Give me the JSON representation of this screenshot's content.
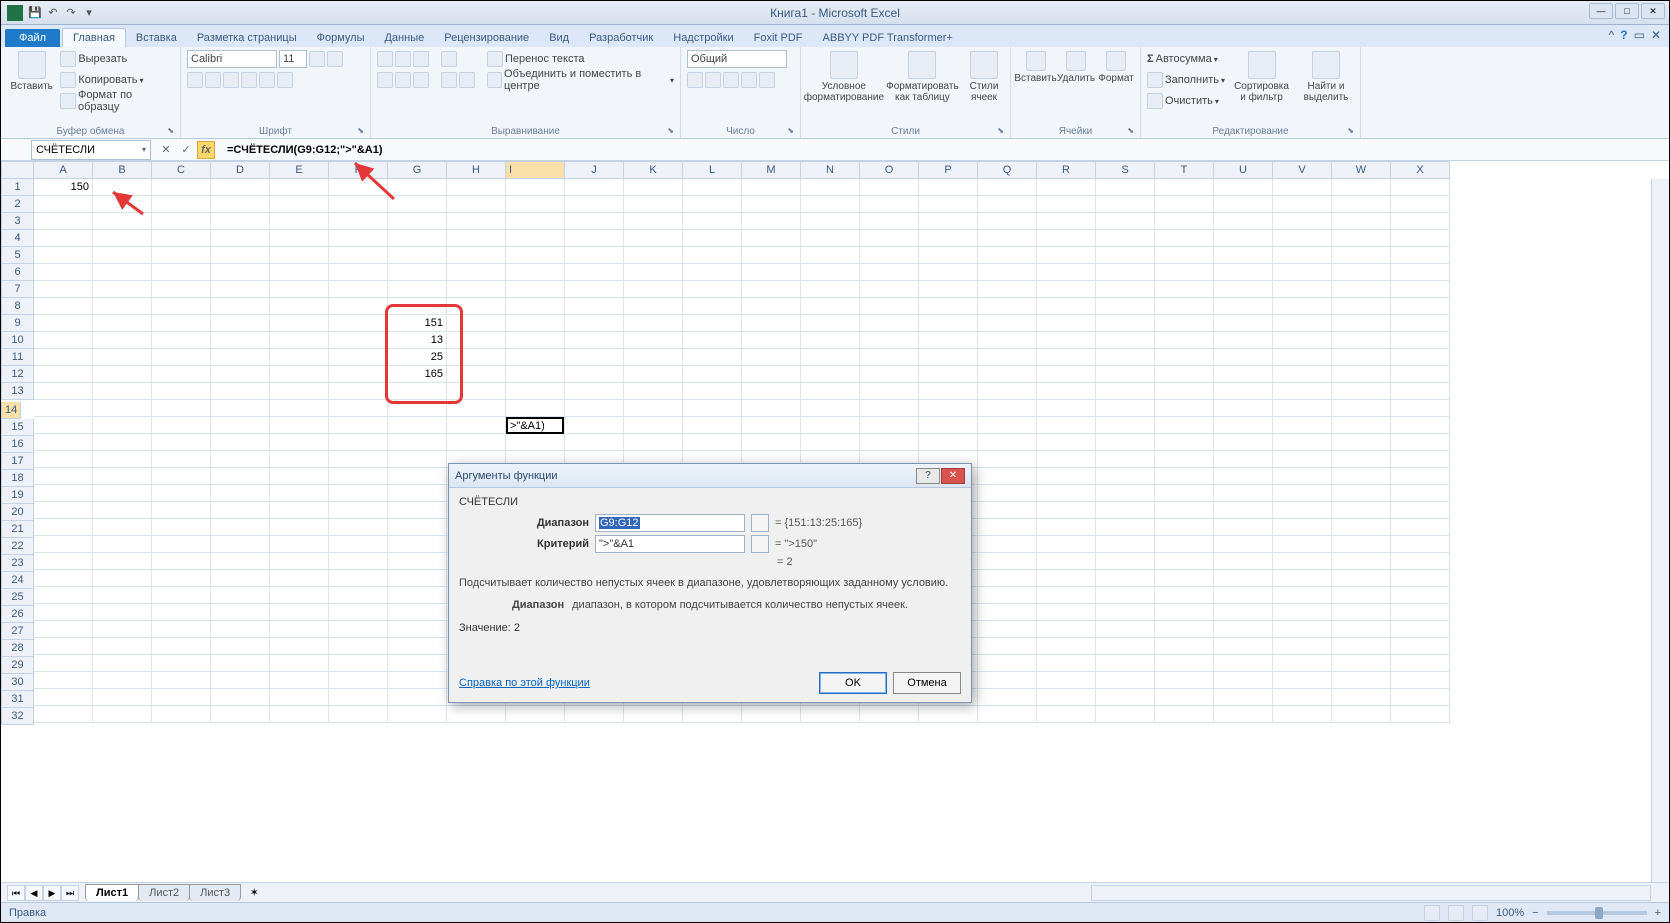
{
  "window": {
    "title": "Книга1 - Microsoft Excel"
  },
  "tabs": {
    "file": "Файл",
    "items": [
      "Главная",
      "Вставка",
      "Разметка страницы",
      "Формулы",
      "Данные",
      "Рецензирование",
      "Вид",
      "Разработчик",
      "Надстройки",
      "Foxit PDF",
      "ABBYY PDF Transformer+"
    ],
    "active": 0
  },
  "ribbon": {
    "clipboard": {
      "paste": "Вставить",
      "cut": "Вырезать",
      "copy": "Копировать",
      "format": "Формат по образцу",
      "label": "Буфер обмена"
    },
    "font": {
      "family": "Calibri",
      "size": "11",
      "label": "Шрифт"
    },
    "align": {
      "wrap": "Перенос текста",
      "merge": "Объединить и поместить в центре",
      "label": "Выравнивание"
    },
    "number": {
      "format": "Общий",
      "label": "Число"
    },
    "styles": {
      "cond": "Условное форматирование",
      "table": "Форматировать как таблицу",
      "cell": "Стили ячеек",
      "label": "Стили"
    },
    "cells": {
      "insert": "Вставить",
      "delete": "Удалить",
      "format": "Формат",
      "label": "Ячейки"
    },
    "editing": {
      "sum": "Автосумма",
      "fill": "Заполнить",
      "clear": "Очистить",
      "sort": "Сортировка и фильтр",
      "find": "Найти и выделить",
      "label": "Редактирование"
    }
  },
  "formula": {
    "name": "СЧЁТЕСЛИ",
    "value": "=СЧЁТЕСЛИ(G9:G12;\">\"&A1)"
  },
  "columns": [
    "A",
    "B",
    "C",
    "D",
    "E",
    "F",
    "G",
    "H",
    "I",
    "J",
    "K",
    "L",
    "M",
    "N",
    "O",
    "P",
    "Q",
    "R",
    "S",
    "T",
    "U",
    "V",
    "W",
    "X"
  ],
  "rows_count": 32,
  "cells": {
    "A1": "150",
    "G9": "151",
    "G10": "13",
    "G11": "25",
    "G12": "165",
    "I14": ">\"&A1)"
  },
  "dialog": {
    "title": "Аргументы функции",
    "func": "СЧЁТЕСЛИ",
    "arg1_label": "Диапазон",
    "arg1_val": "G9:G12",
    "arg1_res": "= {151:13:25:165}",
    "arg2_label": "Критерий",
    "arg2_val": "\">\"&A1",
    "arg2_res": "= \">150\"",
    "result_eq": "= 2",
    "desc1": "Подсчитывает количество непустых ячеек в диапазоне, удовлетворяющих заданному условию.",
    "desc2_label": "Диапазон",
    "desc2": "диапазон, в котором подсчитывается количество непустых ячеек.",
    "value_label": "Значение:",
    "value": "2",
    "help": "Справка по этой функции",
    "ok": "OK",
    "cancel": "Отмена"
  },
  "sheets": {
    "s1": "Лист1",
    "s2": "Лист2",
    "s3": "Лист3"
  },
  "status": {
    "mode": "Правка",
    "zoom": "100%"
  }
}
